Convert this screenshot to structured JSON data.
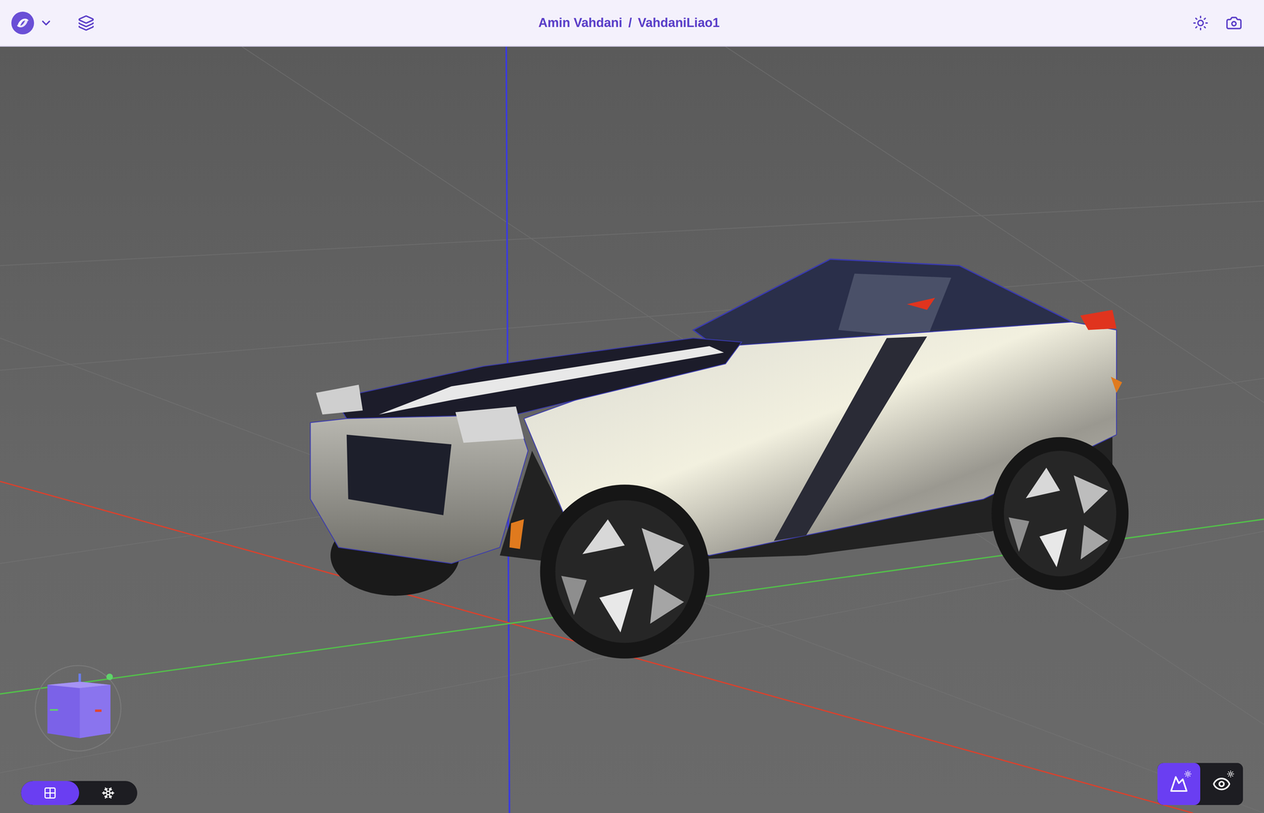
{
  "header": {
    "breadcrumb": [
      {
        "label": "Amin Vahdani"
      },
      {
        "label": "VahdaniLiao1"
      }
    ],
    "separator": "/"
  },
  "view_modes": [
    {
      "kind": "surface",
      "selected": true
    },
    {
      "kind": "wireframe",
      "selected": false
    }
  ],
  "environment_buttons": [
    {
      "kind": "environment",
      "selected": true
    },
    {
      "kind": "visibility",
      "selected": false
    }
  ]
}
